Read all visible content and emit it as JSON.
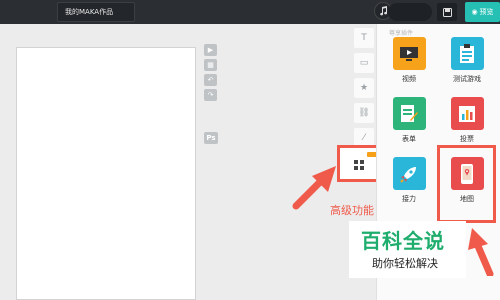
{
  "header": {
    "title": "我的MAKA作品",
    "preview_label": "预览"
  },
  "tools": {
    "vertical_icons": [
      "text-icon",
      "image-icon",
      "star-icon",
      "link-icon",
      "magic-wand-icon"
    ],
    "mini_icons": [
      "play-icon",
      "grid-icon",
      "undo-icon",
      "redo-icon"
    ],
    "ps_label": "Ps"
  },
  "panel": {
    "title": "尊享插件",
    "apps": [
      {
        "label": "视频",
        "color": "#f6a31b"
      },
      {
        "label": "测试游戏",
        "color": "#2ab6d9"
      },
      {
        "label": "表单",
        "color": "#2db47a"
      },
      {
        "label": "投票",
        "color": "#e84c4c"
      },
      {
        "label": "接力",
        "color": "#2ab6d9"
      },
      {
        "label": "地图",
        "color": "#e84c4c"
      }
    ]
  },
  "annotations": {
    "advanced_label": "高级功能"
  },
  "watermark": {
    "main": "百科全说",
    "sub": "助你轻松解决"
  },
  "colors": {
    "accent": "#25c0b3",
    "highlight": "#ef5a4a",
    "brand_green": "#1fad6d"
  }
}
